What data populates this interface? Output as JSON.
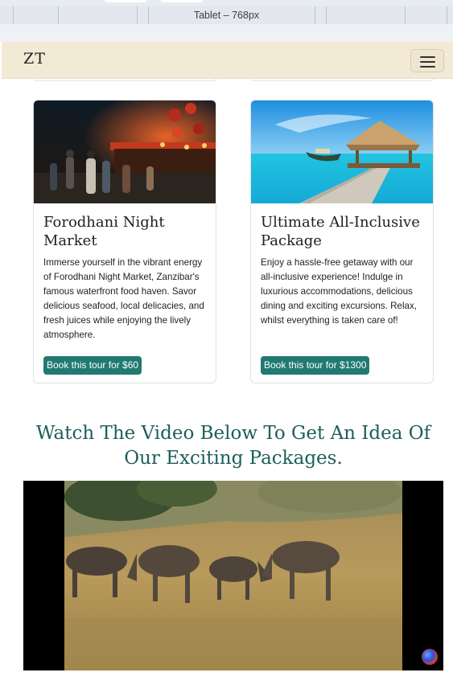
{
  "devtools": {
    "device_label": "Tablet – 768px"
  },
  "navbar": {
    "brand": "ZT",
    "menu_icon": "hamburger-icon"
  },
  "tours": [
    {
      "title": "Forodhani Night Market",
      "description": "Immerse yourself in the vibrant energy of Forodhani Night Market, Zanzibar's famous waterfront food haven. Savor delicious seafood, local delicacies, and fresh juices while enjoying the lively atmosphere.",
      "button": "Book this tour for $60",
      "image": "night-market-photo"
    },
    {
      "title": "Ultimate All-Inclusive Package",
      "description": "Enjoy a hassle-free getaway with our all-inclusive experience! Indulge in luxurious accommodations, delicious dining and exciting excursions. Relax, whilst everything is taken care of!",
      "button": "Book this tour for $1300",
      "image": "beach-pier-photo"
    }
  ],
  "video_section": {
    "heading": "Watch The Video Below To Get An Idea Of Our Exciting Packages.",
    "video": "wildebeest-savanna-video"
  },
  "colors": {
    "accent": "#217a72",
    "heading": "#1c5f5b",
    "navbar_bg": "#f3ead6"
  }
}
